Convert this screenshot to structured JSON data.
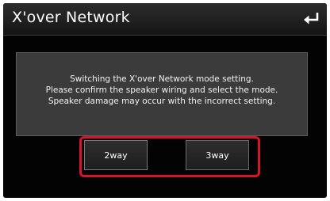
{
  "header": {
    "title": "X'over Network",
    "back_icon": "back-arrow-icon"
  },
  "dialog": {
    "lines": [
      "Switching the X'over Network mode setting.",
      "Please confirm the speaker wiring and select the mode.",
      "Speaker damage may occur with the incorrect setting."
    ]
  },
  "mode_buttons": [
    {
      "label": "2way"
    },
    {
      "label": "3way"
    }
  ],
  "colors": {
    "screen_bg": "#030303",
    "dialog_bg": "#3b3b3b",
    "highlight": "#d9122d"
  }
}
